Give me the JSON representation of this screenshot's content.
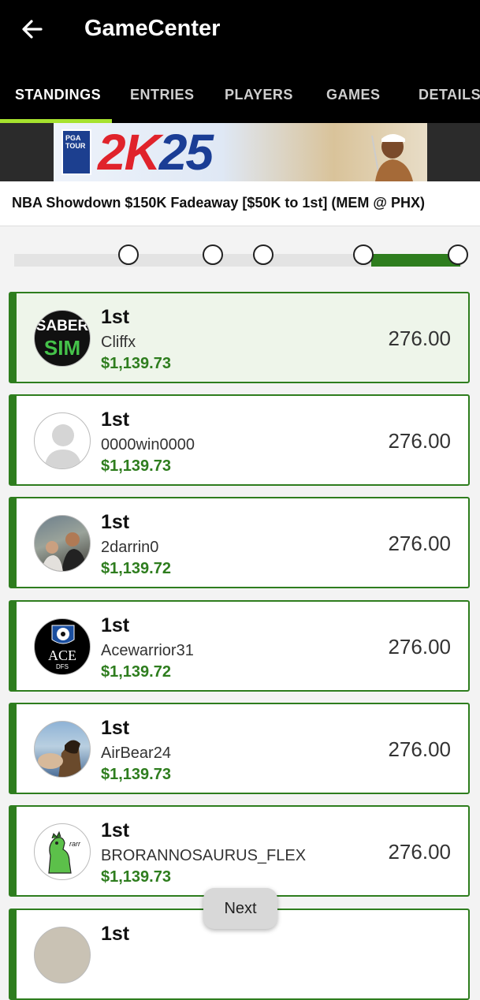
{
  "header": {
    "title": "GameCenter"
  },
  "tabs": [
    {
      "label": "STANDINGS",
      "active": true
    },
    {
      "label": "ENTRIES",
      "active": false
    },
    {
      "label": "PLAYERS",
      "active": false
    },
    {
      "label": "GAMES",
      "active": false
    },
    {
      "label": "DETAILS",
      "active": false
    }
  ],
  "banner": {
    "pga": "PGA TOUR",
    "brand_red": "2K",
    "brand_blue": "25"
  },
  "contest": {
    "name": "NBA Showdown $150K Fadeaway [$50K to 1st] (MEM @ PHX)"
  },
  "progress": {
    "fraction_complete": 0.8
  },
  "entries": [
    {
      "rank": "1st",
      "user": "Cliffx",
      "winnings": "$1,139.73",
      "score": "276.00",
      "avatar_text_1": "SABER",
      "avatar_text_2": "SIM"
    },
    {
      "rank": "1st",
      "user": "0000win0000",
      "winnings": "$1,139.73",
      "score": "276.00"
    },
    {
      "rank": "1st",
      "user": "2darrin0",
      "winnings": "$1,139.72",
      "score": "276.00"
    },
    {
      "rank": "1st",
      "user": "Acewarrior31",
      "winnings": "$1,139.72",
      "score": "276.00",
      "avatar_text_1": "ACE",
      "avatar_text_2": "DFS"
    },
    {
      "rank": "1st",
      "user": "AirBear24",
      "winnings": "$1,139.73",
      "score": "276.00"
    },
    {
      "rank": "1st",
      "user": "BRORANNOSAURUS_FLEX",
      "winnings": "$1,139.73",
      "score": "276.00",
      "avatar_text_1": "rarr"
    },
    {
      "rank": "1st"
    }
  ],
  "pagination": {
    "next_label": "Next"
  },
  "colors": {
    "accent_green": "#2e7d1e",
    "tab_underline": "#a6e22e",
    "header_bg": "#000000"
  }
}
